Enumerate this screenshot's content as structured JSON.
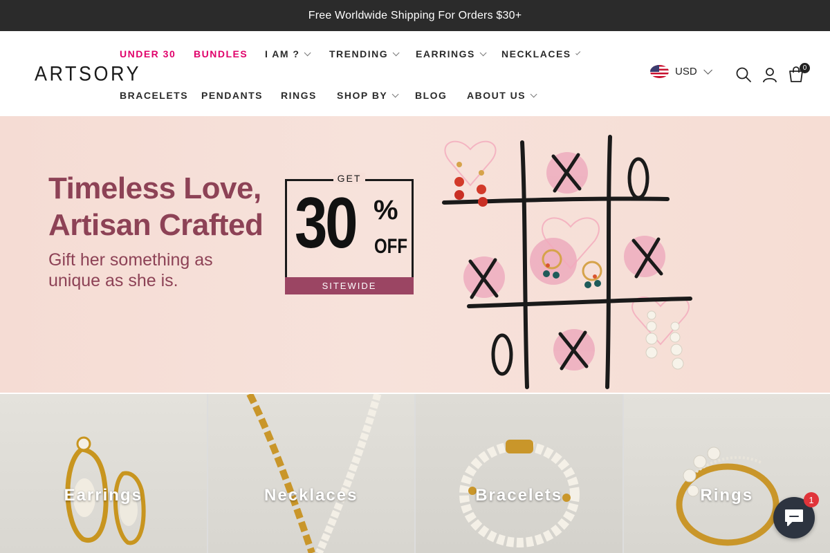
{
  "announcement": {
    "text": "Free Worldwide Shipping For Orders $30+"
  },
  "brand": {
    "logo": "ARTSORY"
  },
  "nav": {
    "row1": [
      {
        "label": "UNDER 30",
        "highlight": true,
        "dropdown": false
      },
      {
        "label": "BUNDLES",
        "highlight": true,
        "dropdown": false
      },
      {
        "label": "I AM ?",
        "highlight": false,
        "dropdown": true
      },
      {
        "label": "TRENDING",
        "highlight": false,
        "dropdown": true
      },
      {
        "label": "EARRINGS",
        "highlight": false,
        "dropdown": true
      },
      {
        "label": "NECKLACES",
        "highlight": false,
        "dropdown": true
      }
    ],
    "row2": [
      {
        "label": "BRACELETS",
        "highlight": false,
        "dropdown": false
      },
      {
        "label": "PENDANTS",
        "highlight": false,
        "dropdown": false
      },
      {
        "label": "RINGS",
        "highlight": false,
        "dropdown": false
      },
      {
        "label": "SHOP BY",
        "highlight": false,
        "dropdown": true
      },
      {
        "label": "BLOG",
        "highlight": false,
        "dropdown": false
      },
      {
        "label": "ABOUT US",
        "highlight": false,
        "dropdown": true
      }
    ]
  },
  "header_tools": {
    "currency": "USD",
    "currency_flag": "us-flag-icon",
    "search_icon": "search-icon",
    "account_icon": "user-icon",
    "cart_icon": "shopping-bag-icon",
    "cart_count": "0"
  },
  "hero": {
    "headline_line1": "Timeless Love,",
    "headline_line2": "Artisan Crafted",
    "sub_line1": "Gift her something as",
    "sub_line2": "unique as she is.",
    "offer_get": "GET",
    "offer_amount": "30",
    "offer_percent": "%",
    "offer_off": "OFF",
    "offer_scope": "SITEWIDE"
  },
  "categories": [
    {
      "label": "Earrings"
    },
    {
      "label": "Necklaces"
    },
    {
      "label": "Bracelets"
    },
    {
      "label": "Rings"
    }
  ],
  "chat": {
    "icon": "chat-icon",
    "unread": "1"
  },
  "colors": {
    "announcement_bg": "#2b2b2b",
    "highlight_nav": "#e0006a",
    "hero_text": "#8d4256",
    "offer_band": "#9b4563",
    "chat_bg": "#2d3440"
  }
}
